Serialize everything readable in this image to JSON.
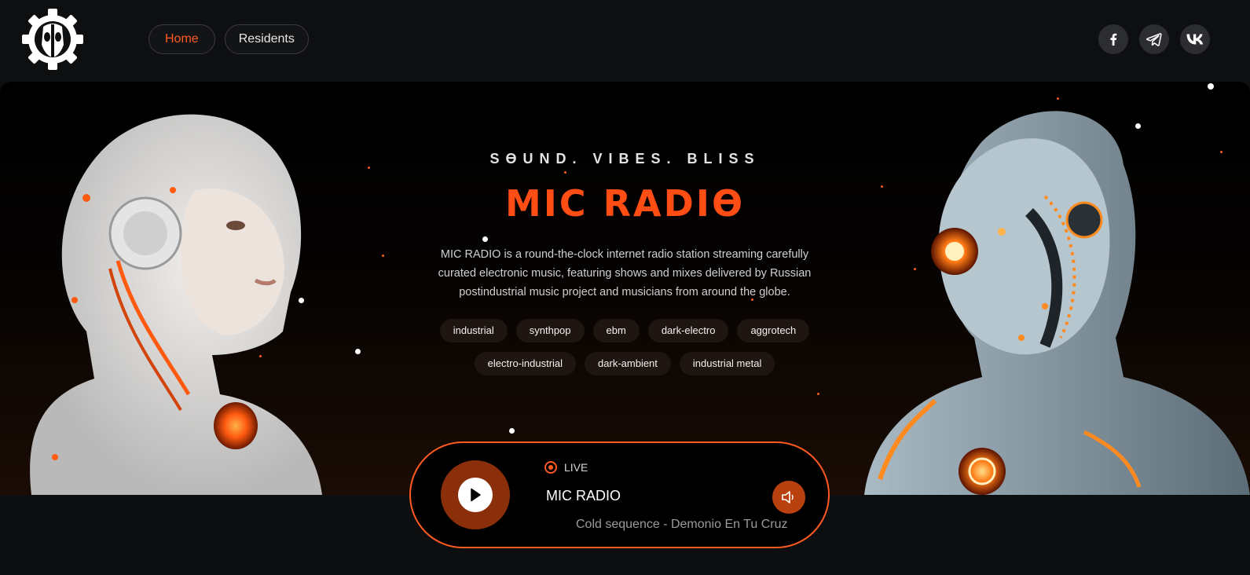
{
  "header": {
    "logo_icon": "gear-mask-logo",
    "nav": [
      {
        "label": "Home",
        "active": true
      },
      {
        "label": "Residents",
        "active": false
      }
    ],
    "socials": [
      {
        "icon": "facebook-icon"
      },
      {
        "icon": "telegram-icon"
      },
      {
        "icon": "vk-icon"
      }
    ]
  },
  "hero": {
    "tagline": "SƟUND. VIBES. BLISS",
    "title": "MIC RADIƟ",
    "description": "MIC RADIO is a round-the-clock internet radio station streaming carefully curated electronic music, featuring shows and mixes delivered by Russian postindustrial music project and musicians from around the globe.",
    "tags": [
      "industrial",
      "synthpop",
      "ebm",
      "dark-electro",
      "aggrotech",
      "electro-industrial",
      "dark-ambient",
      "industrial metal"
    ]
  },
  "player": {
    "live_label": "LIVE",
    "station": "MIC RADIO",
    "track": "Cold sequence - Demonio En Tu Cruz"
  },
  "colors": {
    "accent": "#ff5a1f",
    "background": "#0d0e10"
  }
}
